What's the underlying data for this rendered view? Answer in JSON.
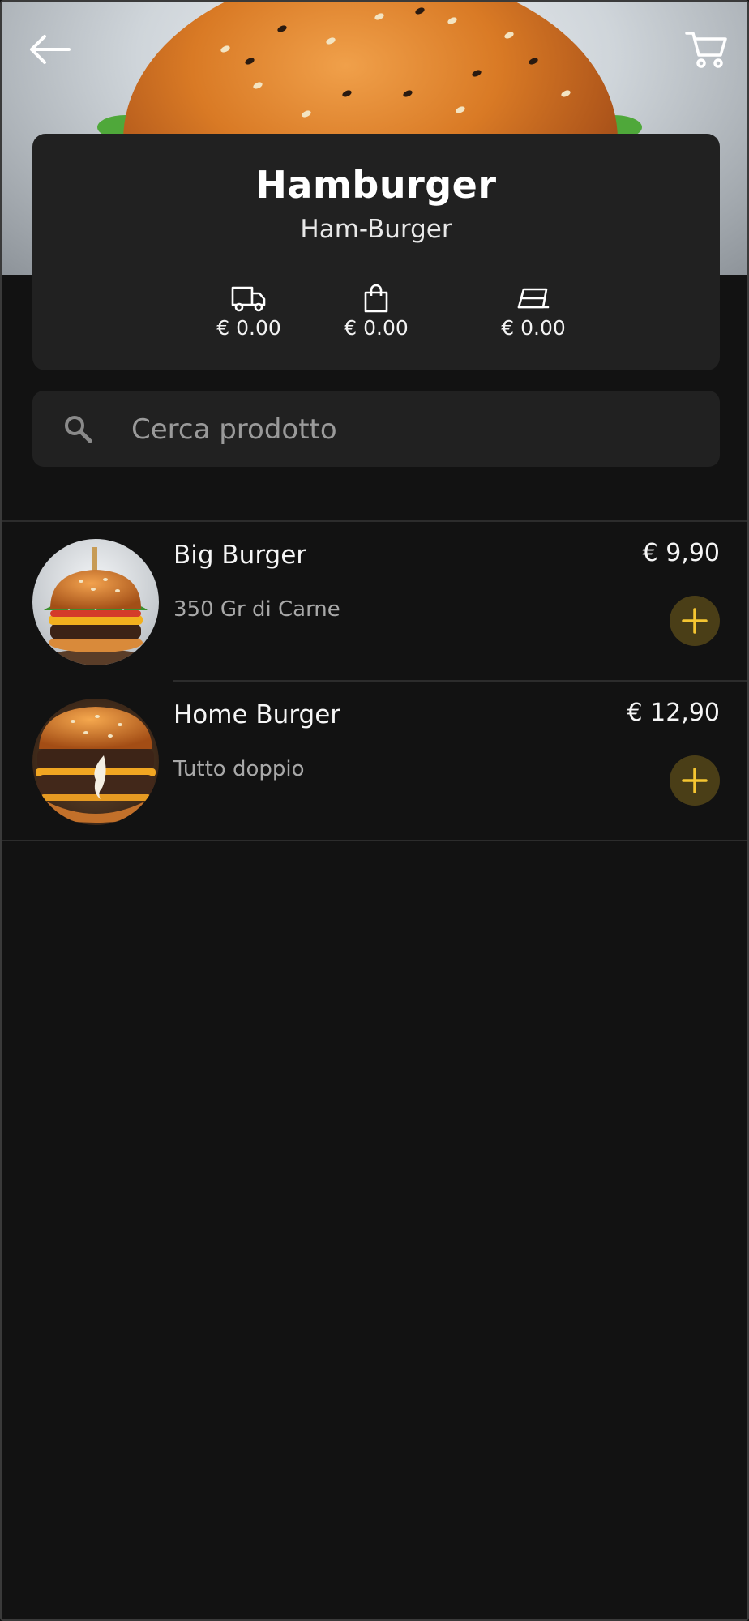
{
  "header": {
    "back_icon": "arrow-left-icon",
    "cart_icon": "cart-icon"
  },
  "category": {
    "title": "Hamburger",
    "subtitle": "Ham-Burger",
    "services": [
      {
        "icon": "delivery-truck-icon",
        "value": "€ 0.00"
      },
      {
        "icon": "shopping-bag-icon",
        "value": "€ 0.00"
      },
      {
        "icon": "table-icon",
        "value": "€ 0.00"
      }
    ]
  },
  "search": {
    "placeholder": "Cerca prodotto",
    "value": ""
  },
  "products": [
    {
      "name": "Big Burger",
      "description": "350 Gr di Carne",
      "price": "€ 9,90"
    },
    {
      "name": "Home Burger",
      "description": "Tutto doppio",
      "price": "€ 12,90"
    }
  ],
  "colors": {
    "background": "#121212",
    "card": "#212121",
    "accent": "#f5c531",
    "accent_bg": "#4a3e17"
  }
}
